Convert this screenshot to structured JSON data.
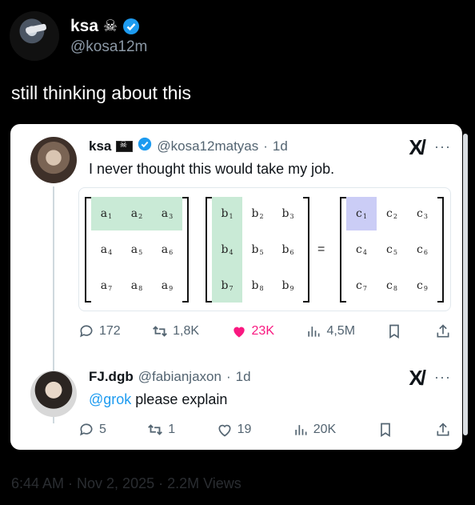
{
  "post": {
    "author_name": "ksa",
    "author_handle": "@kosa12m",
    "text": "still thinking about this",
    "footer": "6:44 AM · Nov 2, 2025 · 2.2M Views"
  },
  "screenshot": {
    "tweet1": {
      "name": "ksa",
      "handle": "@kosa12matyas",
      "time": "1d",
      "text": "I never thought this would take my job.",
      "replies": "172",
      "reposts": "1,8K",
      "likes": "23K",
      "views": "4,5M",
      "matrix_a": [
        "a1",
        "a2",
        "a3",
        "a4",
        "a5",
        "a6",
        "a7",
        "a8",
        "a9"
      ],
      "matrix_b": [
        "b1",
        "b2",
        "b3",
        "b4",
        "b5",
        "b6",
        "b7",
        "b8",
        "b9"
      ],
      "matrix_c": [
        "c1",
        "c2",
        "c3",
        "c4",
        "c5",
        "c6",
        "c7",
        "c8",
        "c9"
      ],
      "equals": "="
    },
    "tweet2": {
      "name": "FJ.dgb",
      "handle": "@fabianjaxon",
      "time": "1d",
      "mention": "@grok",
      "text": " please explain",
      "replies": "5",
      "reposts": "1",
      "likes": "19",
      "views": "20K"
    },
    "more_label": "···",
    "dot_separator": "·",
    "logo_text": "X/"
  },
  "colors": {
    "verified": "#1d9bf0",
    "like": "#f91880",
    "green_highlight": "#c9ead6",
    "blue_highlight": "#cbcdf6"
  }
}
